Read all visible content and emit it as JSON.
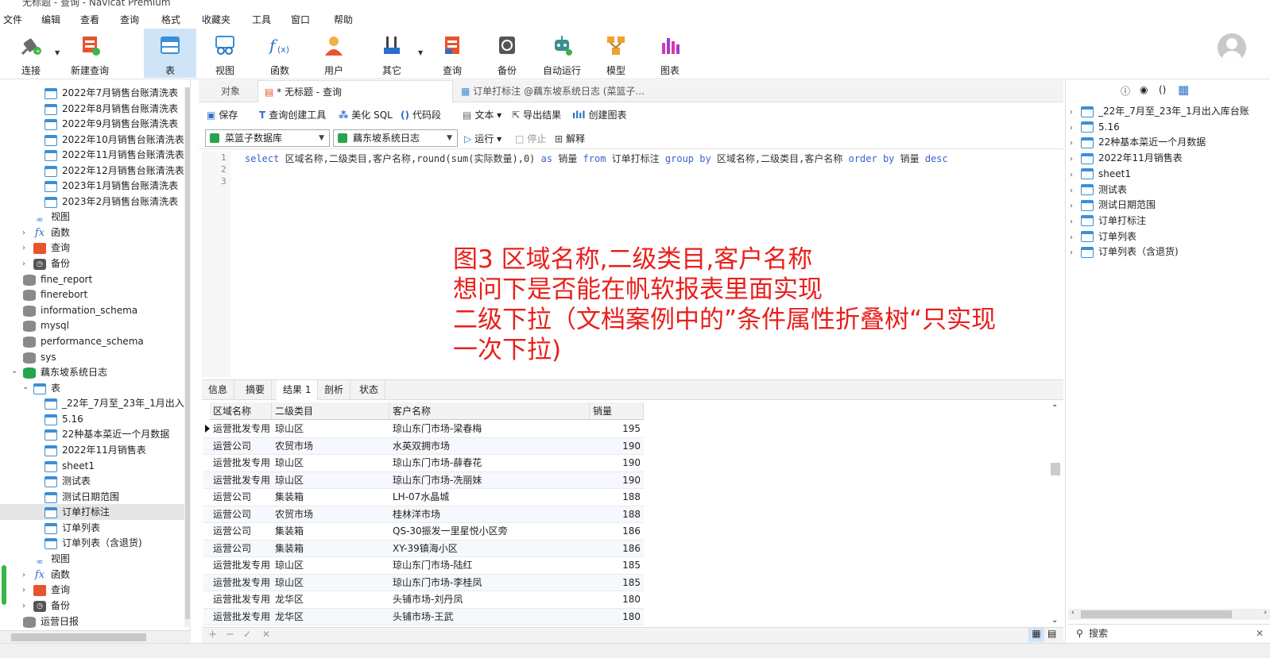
{
  "window": {
    "title": "无标题 - 查询 - Navicat Premium"
  },
  "menu": [
    "文件",
    "编辑",
    "查看",
    "查询",
    "格式",
    "收藏夹",
    "工具",
    "窗口",
    "帮助"
  ],
  "toolbar": {
    "connect": "连接",
    "new_query": "新建查询",
    "table": "表",
    "view": "视图",
    "function": "函数",
    "user": "用户",
    "other": "其它",
    "query": "查询",
    "backup": "备份",
    "auto_run": "自动运行",
    "model": "模型",
    "chart": "图表"
  },
  "left_tree": {
    "items": [
      {
        "label": "2022年7月销售台账清洗表"
      },
      {
        "label": "2022年8月销售台账清洗表"
      },
      {
        "label": "2022年9月销售台账清洗表"
      },
      {
        "label": "2022年10月销售台账清洗表"
      },
      {
        "label": "2022年11月销售台账清洗表"
      },
      {
        "label": "2022年12月销售台账清洗表"
      },
      {
        "label": "2023年1月销售台账清洗表"
      },
      {
        "label": "2023年2月销售台账清洗表"
      },
      {
        "label": "视图"
      },
      {
        "label": "函数"
      },
      {
        "label": "查询"
      },
      {
        "label": "备份"
      },
      {
        "label": "fine_report"
      },
      {
        "label": "finerebort"
      },
      {
        "label": "information_schema"
      },
      {
        "label": "mysql"
      },
      {
        "label": "performance_schema"
      },
      {
        "label": "sys"
      },
      {
        "label": "藕东坡系统日志"
      },
      {
        "label": "表"
      },
      {
        "label": "_22年_7月至_23年_1月出入库"
      },
      {
        "label": "5.16"
      },
      {
        "label": "22种基本菜近一个月数据"
      },
      {
        "label": "2022年11月销售表"
      },
      {
        "label": "sheet1"
      },
      {
        "label": "测试表"
      },
      {
        "label": "测试日期范围"
      },
      {
        "label": "订单打标注"
      },
      {
        "label": "订单列表"
      },
      {
        "label": "订单列表（含退货)"
      },
      {
        "label": "视图"
      },
      {
        "label": "函数"
      },
      {
        "label": "查询"
      },
      {
        "label": "备份"
      },
      {
        "label": "运营日报"
      }
    ]
  },
  "tabs": {
    "objects": "对象",
    "query": "* 无标题 - 查询",
    "table": "订单打标注 @藕东坡系统日志 (菜篮子..."
  },
  "editor_toolbar": {
    "save": "保存",
    "query_builder": "查询创建工具",
    "beautify": "美化 SQL",
    "snippet": "代码段",
    "text": "文本",
    "export": "导出结果",
    "create_chart": "创建图表",
    "run": "运行",
    "stop": "停止",
    "explain": "解释"
  },
  "connection": {
    "value": "菜篮子数据库"
  },
  "database": {
    "value": "藕东坡系统日志"
  },
  "sql": {
    "lines": [
      "1",
      "2",
      "3"
    ],
    "p1": "select",
    "p2": " 区域名称,二级类目,客户名称,round(sum(实际数量),0) ",
    "p3": "as",
    "p4": " 销量 ",
    "p5": "from",
    "p6": " 订单打标注 ",
    "p7": "group by",
    "p8": " 区域名称,二级类目,客户名称 ",
    "p9": "order by",
    "p10": " 销量 ",
    "p11": "desc"
  },
  "annotation": {
    "line1": "图3 区域名称,二级类目,客户名称",
    "line2": "想问下是否能在帆软报表里面实现",
    "line3": "二级下拉（文档案例中的”条件属性折叠树“只实现",
    "line4": "一次下拉)"
  },
  "result_tabs": [
    "信息",
    "摘要",
    "结果 1",
    "剖析",
    "状态"
  ],
  "grid": {
    "columns": [
      "区域名称",
      "二级类目",
      "客户名称",
      "销量"
    ],
    "rows": [
      [
        "运营批发专用",
        "琼山区",
        "琼山东门市场-梁春梅",
        "195"
      ],
      [
        "运营公司",
        "农贸市场",
        "水英双拥市场",
        "190"
      ],
      [
        "运营批发专用",
        "琼山区",
        "琼山东门市场-薛春花",
        "190"
      ],
      [
        "运营批发专用",
        "琼山区",
        "琼山东门市场-冼丽妹",
        "190"
      ],
      [
        "运营公司",
        "集装箱",
        "LH-07水晶城",
        "188"
      ],
      [
        "运营公司",
        "农贸市场",
        "桂林洋市场",
        "188"
      ],
      [
        "运营公司",
        "集装箱",
        "QS-30振发一里星悦小区旁",
        "186"
      ],
      [
        "运营公司",
        "集装箱",
        "XY-39镇海小区",
        "186"
      ],
      [
        "运营批发专用",
        "琼山区",
        "琼山东门市场-陆红",
        "185"
      ],
      [
        "运营批发专用",
        "琼山区",
        "琼山东门市场-李桂凤",
        "185"
      ],
      [
        "运营批发专用",
        "龙华区",
        "头铺市场-刘丹凤",
        "180"
      ],
      [
        "运营批发专用",
        "龙华区",
        "头铺市场-王武",
        "180"
      ]
    ]
  },
  "right_panel": {
    "items": [
      {
        "label": "_22年_7月至_23年_1月出入库台账"
      },
      {
        "label": "5.16"
      },
      {
        "label": "22种基本菜近一个月数据"
      },
      {
        "label": "2022年11月销售表"
      },
      {
        "label": "sheet1"
      },
      {
        "label": "测试表"
      },
      {
        "label": "测试日期范围"
      },
      {
        "label": "订单打标注"
      },
      {
        "label": "订单列表"
      },
      {
        "label": "订单列表（含退货)"
      }
    ],
    "search_placeholder": "搜索"
  },
  "colors": {
    "accent": "#3b8fd6",
    "annotation": "#e8201c",
    "keyword": "#3a5fd0"
  }
}
